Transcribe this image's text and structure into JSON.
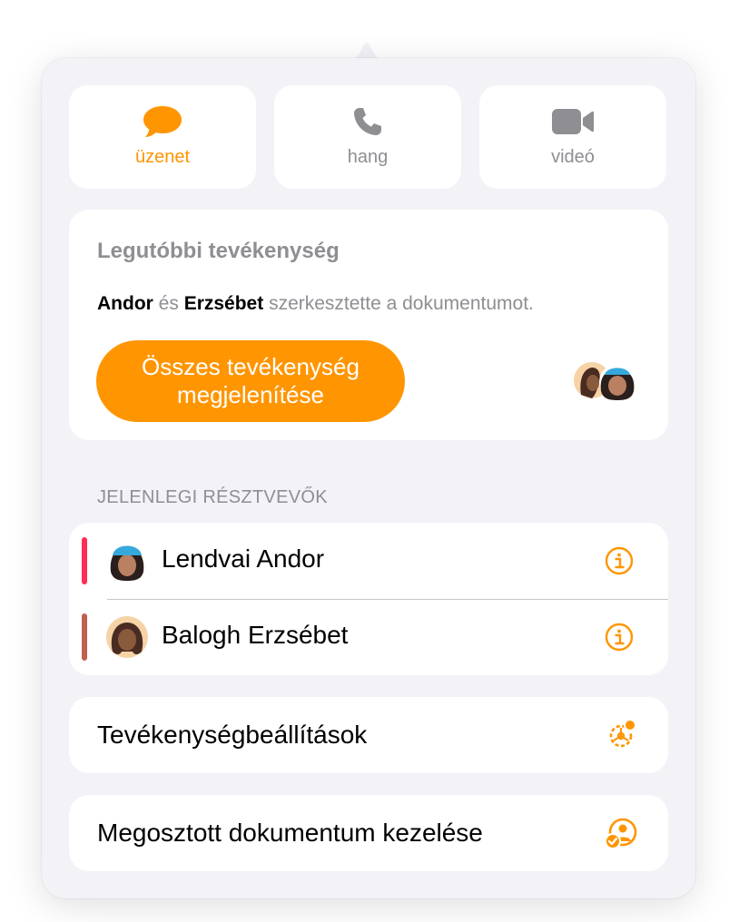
{
  "actions": [
    {
      "label": "üzenet",
      "icon": "message-bubble-icon",
      "active": true
    },
    {
      "label": "hang",
      "icon": "phone-icon",
      "active": false
    },
    {
      "label": "videó",
      "icon": "video-camera-icon",
      "active": false
    }
  ],
  "activity": {
    "title": "Legutóbbi tevékenység",
    "name1": "Andor",
    "conj": " és ",
    "name2": "Erzsébet",
    "rest": " szerkesztette a dokumentumot.",
    "button_line1": "Összes tevékenység",
    "button_line2": "megjelenítése"
  },
  "participants": {
    "header": "JELENLEGI RÉSZTVEVŐK",
    "items": [
      {
        "name": "Lendvai Andor",
        "color": "#ff2d55"
      },
      {
        "name": "Balogh Erzsébet",
        "color": "#c0604f"
      }
    ]
  },
  "settings": {
    "label": "Tevékenységbeállítások",
    "icon": "activity-settings-gear-icon"
  },
  "manage": {
    "label": "Megosztott dokumentum kezelése",
    "icon": "manage-shared-person-icon"
  },
  "colors": {
    "accent": "#ff9500",
    "background": "#f2f2f7",
    "secondary_text": "#8e8e93"
  }
}
